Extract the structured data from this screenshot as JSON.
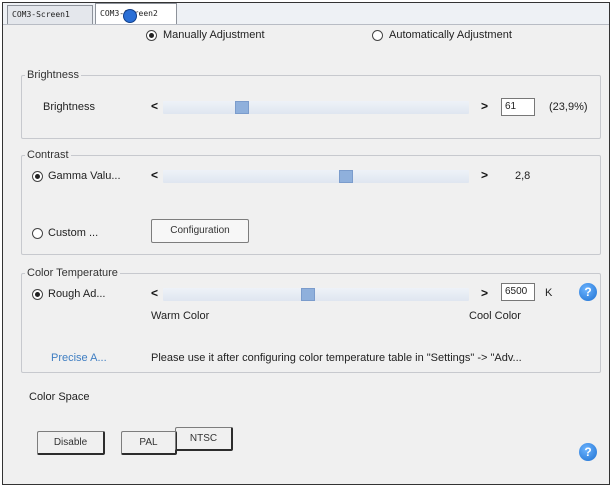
{
  "tabs": [
    {
      "label": "COM3-Screen1"
    },
    {
      "label": "COM3-Screen2"
    }
  ],
  "mode": {
    "manual_label": "Manually Adjustment",
    "auto_label": "Automatically Adjustment"
  },
  "brightness": {
    "group_title": "Brightness",
    "label": "Brightness",
    "value": "61",
    "percent": "(23,9%)",
    "slider_fraction": 0.239
  },
  "contrast": {
    "group_title": "Contrast",
    "gamma_label": "Gamma Valu...",
    "gamma_value": "2,8",
    "custom_label": "Custom ...",
    "configuration_button": "Configuration",
    "slider_fraction": 0.5
  },
  "color_temperature": {
    "group_title": "Color Temperature",
    "rough_label": "Rough Ad...",
    "value": "6500",
    "unit": "K",
    "warm_label": "Warm Color",
    "cool_label": "Cool Color",
    "precise_label": "Precise A...",
    "hint": "Please use it after configuring color temperature table in \"Settings\" -> \"Adv...",
    "slider_fraction": 0.45
  },
  "color_space": {
    "title": "Color Space",
    "buttons": [
      "Disable",
      "PAL",
      "NTSC"
    ]
  },
  "icons": {
    "help": "?",
    "arrow_left": "<",
    "arrow_right": ">"
  },
  "colors": {
    "thumb": "#8fb0dc",
    "help": "#1c6fd0"
  }
}
